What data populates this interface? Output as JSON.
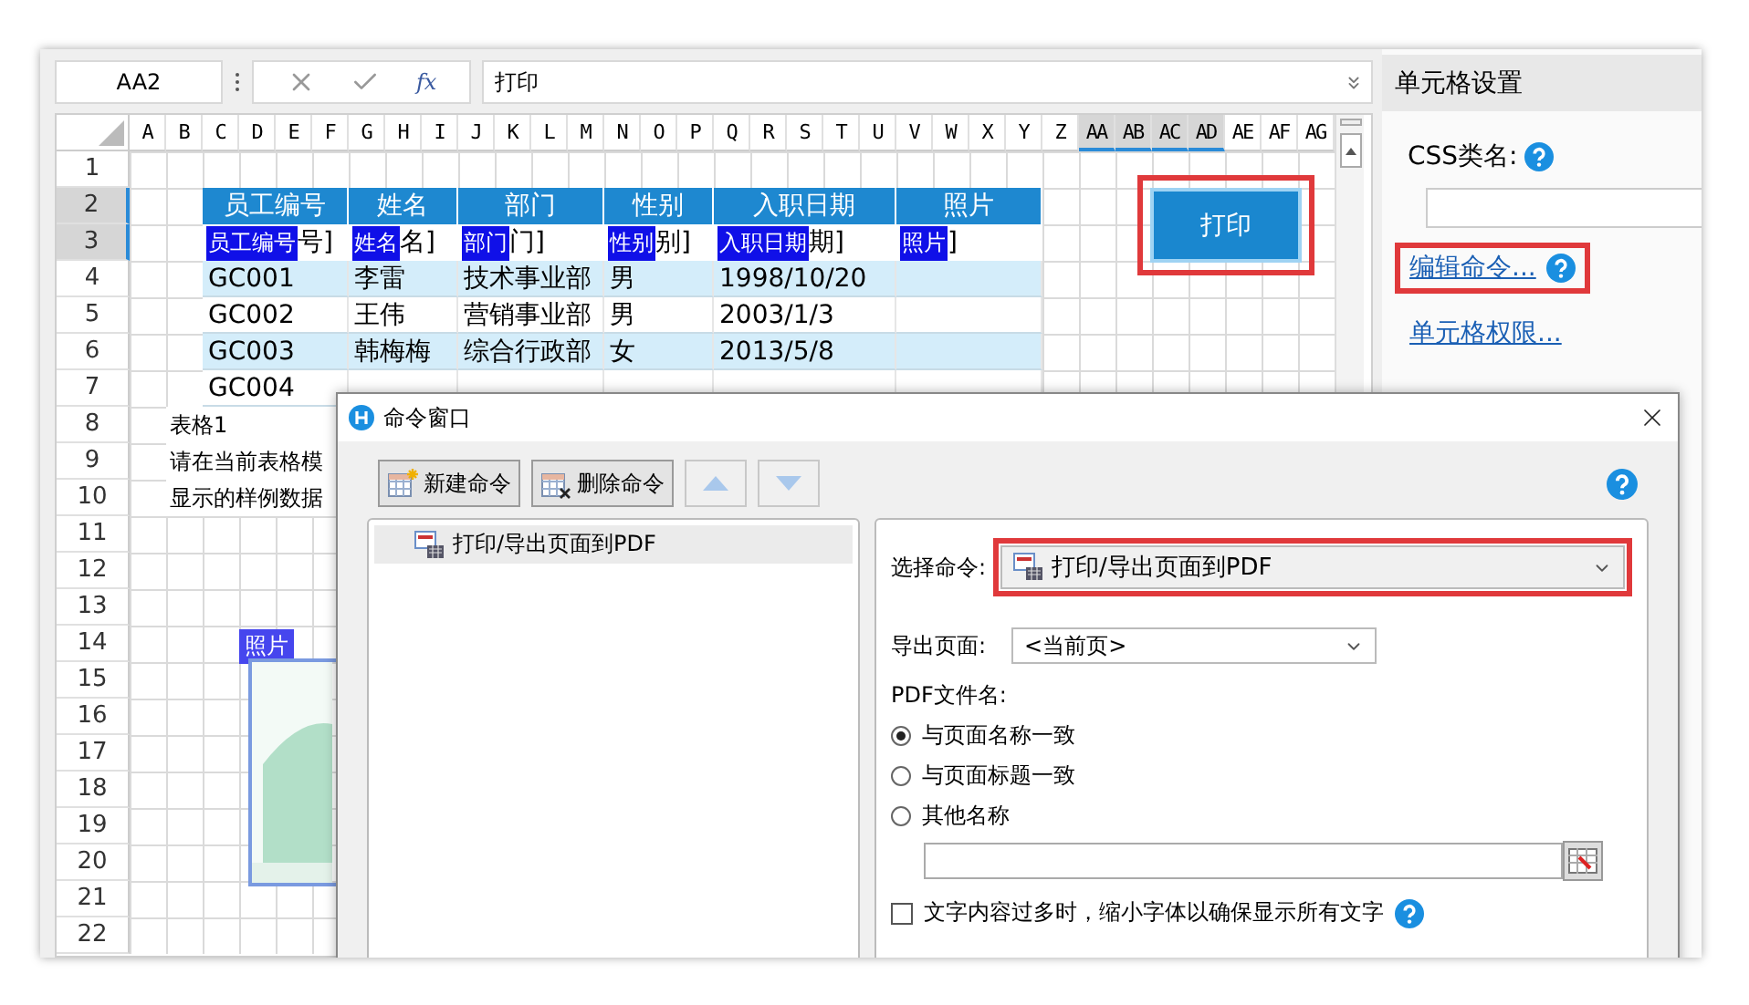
{
  "formula_bar": {
    "cell_ref": "AA2",
    "function_label": "fx",
    "formula": "打印"
  },
  "sheet": {
    "columns": [
      {
        "label": "A",
        "selected": false
      },
      {
        "label": "B",
        "selected": false
      },
      {
        "label": "C",
        "selected": false
      },
      {
        "label": "D",
        "selected": false
      },
      {
        "label": "E",
        "selected": false
      },
      {
        "label": "F",
        "selected": false
      },
      {
        "label": "G",
        "selected": false
      },
      {
        "label": "H",
        "selected": false
      },
      {
        "label": "I",
        "selected": false
      },
      {
        "label": "J",
        "selected": false
      },
      {
        "label": "K",
        "selected": false
      },
      {
        "label": "L",
        "selected": false
      },
      {
        "label": "M",
        "selected": false
      },
      {
        "label": "N",
        "selected": false
      },
      {
        "label": "O",
        "selected": false
      },
      {
        "label": "P",
        "selected": false
      },
      {
        "label": "Q",
        "selected": false
      },
      {
        "label": "R",
        "selected": false
      },
      {
        "label": "S",
        "selected": false
      },
      {
        "label": "T",
        "selected": false
      },
      {
        "label": "U",
        "selected": false
      },
      {
        "label": "V",
        "selected": false
      },
      {
        "label": "W",
        "selected": false
      },
      {
        "label": "X",
        "selected": false
      },
      {
        "label": "Y",
        "selected": false
      },
      {
        "label": "Z",
        "selected": false
      },
      {
        "label": "AA",
        "selected": true
      },
      {
        "label": "AB",
        "selected": true
      },
      {
        "label": "AC",
        "selected": true
      },
      {
        "label": "AD",
        "selected": true
      },
      {
        "label": "AE",
        "selected": false
      },
      {
        "label": "AF",
        "selected": false
      },
      {
        "label": "AG",
        "selected": false
      }
    ],
    "rows": [
      {
        "label": "1",
        "selected": false
      },
      {
        "label": "2",
        "selected": true
      },
      {
        "label": "3",
        "selected": true
      },
      {
        "label": "4",
        "selected": false
      },
      {
        "label": "5",
        "selected": false
      },
      {
        "label": "6",
        "selected": false
      },
      {
        "label": "7",
        "selected": false
      },
      {
        "label": "8",
        "selected": false
      },
      {
        "label": "9",
        "selected": false
      },
      {
        "label": "10",
        "selected": false
      },
      {
        "label": "11",
        "selected": false
      },
      {
        "label": "12",
        "selected": false
      },
      {
        "label": "13",
        "selected": false
      },
      {
        "label": "14",
        "selected": false
      },
      {
        "label": "15",
        "selected": false
      },
      {
        "label": "16",
        "selected": false
      },
      {
        "label": "17",
        "selected": false
      },
      {
        "label": "18",
        "selected": false
      },
      {
        "label": "19",
        "selected": false
      },
      {
        "label": "20",
        "selected": false
      },
      {
        "label": "21",
        "selected": false
      },
      {
        "label": "22",
        "selected": false
      }
    ],
    "table_header": [
      "员工编号",
      "姓名",
      "部门",
      "性别",
      "入职日期",
      "照片"
    ],
    "template_row": [
      {
        "field": "员工编号",
        "tail": "号]"
      },
      {
        "field": "姓名",
        "tail": "名]"
      },
      {
        "field": "部门",
        "tail": "门]"
      },
      {
        "field": "性别",
        "tail": "别]"
      },
      {
        "field": "入职日期",
        "tail": "期]"
      },
      {
        "field": "照片",
        "tail": "]"
      }
    ],
    "data_rows": [
      [
        "GC001",
        "李雷",
        "技术事业部",
        "男",
        "1998/10/20"
      ],
      [
        "GC002",
        "王伟",
        "营销事业部",
        "男",
        "2003/1/3"
      ],
      [
        "GC003",
        "韩梅梅",
        "综合行政部",
        "女",
        "2013/5/8"
      ],
      [
        "GC004"
      ]
    ],
    "note_lines": [
      "表格1",
      "请在当前表格模",
      "显示的样例数据"
    ],
    "button": {
      "label": "打印",
      "highlighted": true
    },
    "picture_field": {
      "label": "照片"
    }
  },
  "cell_settings": {
    "title": "单元格设置",
    "css_label": "CSS类名:",
    "links": [
      {
        "label": "编辑命令...",
        "highlighted": true,
        "help": true
      },
      {
        "label": "单元格权限...",
        "highlighted": false,
        "help": false
      }
    ]
  },
  "dialog": {
    "title": "命令窗口",
    "toolbar": [
      {
        "kind": "new",
        "label": "新建命令",
        "disabled": false
      },
      {
        "kind": "delete",
        "label": "删除命令",
        "disabled": false
      },
      {
        "kind": "up",
        "disabled": true
      },
      {
        "kind": "down",
        "disabled": true
      }
    ],
    "commands": [
      {
        "label": "打印/导出页面到PDF",
        "selected": true
      }
    ],
    "select_label": "选择命令:",
    "selected_command": {
      "value": "打印/导出页面到PDF",
      "highlighted": true
    },
    "export_label": "导出页面:",
    "export_value": "<当前页>",
    "file_label": "PDF文件名:",
    "file_options": [
      {
        "label": "与页面名称一致",
        "selected": true
      },
      {
        "label": "与页面标题一致",
        "selected": false
      },
      {
        "label": "其他名称",
        "selected": false
      }
    ],
    "shrink": {
      "label": "文字内容过多时，缩小字体以确保显示所有文字",
      "checked": false
    }
  }
}
